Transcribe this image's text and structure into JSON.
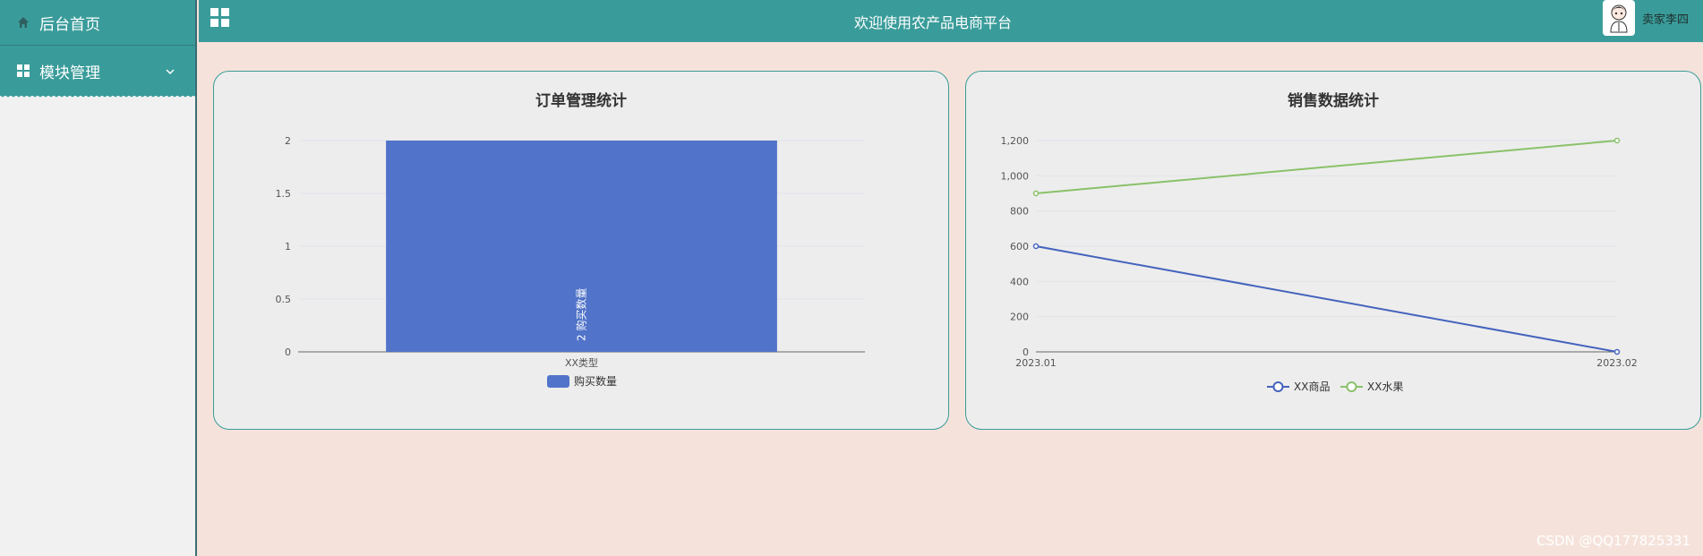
{
  "sidebar": {
    "items": [
      {
        "label": "后台首页",
        "icon": "home-icon"
      },
      {
        "label": "模块管理",
        "icon": "grid-icon"
      }
    ]
  },
  "header": {
    "welcome": "欢迎使用农产品电商平台",
    "user_name": "卖家李四"
  },
  "colors": {
    "accent": "#3a9c9a",
    "background": "#f5e3db",
    "bar": "#5173c9",
    "series_blue": "#4463bd",
    "series_green": "#8ac16a"
  },
  "chart_data": [
    {
      "type": "bar",
      "title": "订单管理统计",
      "categories": [
        "XX类型"
      ],
      "series": [
        {
          "name": "购买数量",
          "values": [
            2
          ]
        }
      ],
      "yticks": [
        "0",
        "0.5",
        "1",
        "1.5",
        "2"
      ],
      "ylim": [
        0,
        2
      ],
      "data_label": "2  购买数量",
      "legend_position": "bottom-center"
    },
    {
      "type": "line",
      "title": "销售数据统计",
      "x": [
        "2023.01",
        "2023.02"
      ],
      "series": [
        {
          "name": "XX商品",
          "values": [
            600,
            0
          ]
        },
        {
          "name": "XX水果",
          "values": [
            900,
            1200
          ]
        }
      ],
      "yticks": [
        "0",
        "200",
        "400",
        "600",
        "800",
        "1,000",
        "1,200"
      ],
      "ylim": [
        0,
        1200
      ],
      "legend_position": "bottom-center"
    }
  ],
  "watermark": "CSDN @QQ177825331"
}
